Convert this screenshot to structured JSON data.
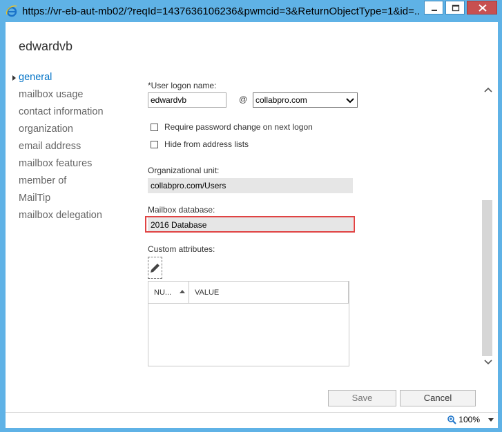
{
  "window": {
    "title": "https://vr-eb-aut-mb02/?reqId=1437636106236&pwmcid=3&ReturnObjectType=1&id=..."
  },
  "header": {
    "title": "edwardvb"
  },
  "nav": {
    "items": [
      {
        "label": "general",
        "active": true
      },
      {
        "label": "mailbox usage"
      },
      {
        "label": "contact information"
      },
      {
        "label": "organization"
      },
      {
        "label": "email address"
      },
      {
        "label": "mailbox features"
      },
      {
        "label": "member of"
      },
      {
        "label": "MailTip"
      },
      {
        "label": "mailbox delegation"
      }
    ]
  },
  "form": {
    "logon_label": "*User logon name:",
    "logon_value": "edwardvb",
    "at_sign": "@",
    "domain_value": "collabpro.com",
    "require_pwd_label": "Require password change on next logon",
    "hide_label": "Hide from address lists",
    "ou_label": "Organizational unit:",
    "ou_value": "collabpro.com/Users",
    "db_label": "Mailbox database:",
    "db_value": "2016 Database",
    "custom_label": "Custom attributes:",
    "table": {
      "col_number": "NU...",
      "col_value": "VALUE"
    }
  },
  "buttons": {
    "save": "Save",
    "cancel": "Cancel"
  },
  "status": {
    "zoom": "100%"
  },
  "colors": {
    "frame": "#5fb2e6",
    "accent": "#0072c6",
    "highlight": "#e04343"
  }
}
